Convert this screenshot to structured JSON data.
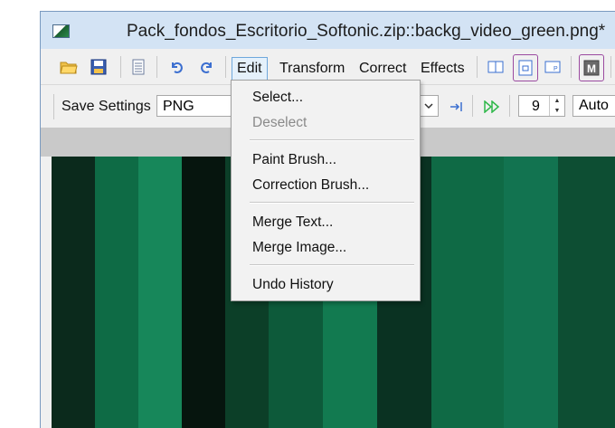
{
  "window": {
    "title": "Pack_fondos_Escritorio_Softonic.zip::backg_video_green.png*"
  },
  "toolbar": {
    "icons": [
      "open-folder-icon",
      "save-icon",
      "properties-icon",
      "undo-icon",
      "redo-icon"
    ],
    "right_icons": [
      "single-view-icon",
      "fit-view-icon",
      "page-view-icon",
      "meta-icon"
    ]
  },
  "menu": {
    "items": [
      {
        "label": "Edit"
      },
      {
        "label": "Transform"
      },
      {
        "label": "Correct"
      },
      {
        "label": "Effects"
      }
    ]
  },
  "options": {
    "save_settings_label": "Save Settings",
    "format_value": "PNG",
    "quality_value": "9",
    "mode_value": "Auto"
  },
  "edit_menu": {
    "groups": [
      [
        {
          "label": "Select...",
          "enabled": true
        },
        {
          "label": "Deselect",
          "enabled": false
        }
      ],
      [
        {
          "label": "Paint Brush...",
          "enabled": true
        },
        {
          "label": "Correction Brush...",
          "enabled": true
        }
      ],
      [
        {
          "label": "Merge Text...",
          "enabled": true
        },
        {
          "label": "Merge Image...",
          "enabled": true
        }
      ],
      [
        {
          "label": "Undo History",
          "enabled": true
        }
      ]
    ]
  },
  "colors": {
    "accent_blue": "#6fa8dc",
    "title_bg": "#d3e3f4"
  }
}
